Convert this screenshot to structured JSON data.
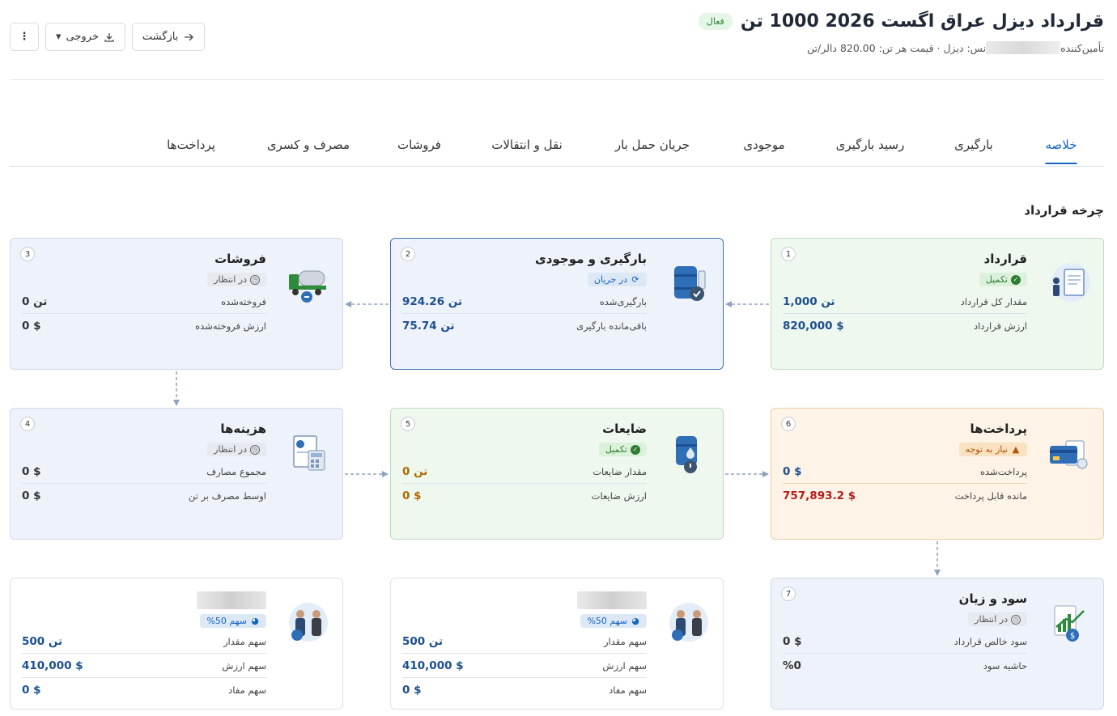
{
  "header": {
    "title": "قرارداد دیزل عراق اگست 2026 1000 تن",
    "status_badge": "فعال",
    "subtitle_prefix": "تأمین‌کننده",
    "subtitle_rest": "نس: دیزل · قیمت هر تن: 820.00 دالر/تن"
  },
  "actions": {
    "back": "بازگشت",
    "export": "خروجی",
    "more": "⋮"
  },
  "tabs": [
    "خلاصه",
    "بارگیری",
    "رسید بارگیری",
    "موجودی",
    "جریان حمل بار",
    "نقل و انتقالات",
    "فروشات",
    "مصرف و کسری",
    "پرداخت‌ها"
  ],
  "section_title": "چرخه قرارداد",
  "cards": {
    "contract": {
      "num": "1",
      "title": "قرارداد",
      "status": "تکمیل",
      "rows": [
        {
          "label": "مقدار کل قرارداد",
          "value": "1,000 تن"
        },
        {
          "label": "ارزش قرارداد",
          "value": "820,000 $"
        }
      ]
    },
    "loading": {
      "num": "2",
      "title": "بارگیری و موجودی",
      "status": "در جریان",
      "rows": [
        {
          "label": "بارگیری‌شده",
          "value": "924.26 تن"
        },
        {
          "label": "باقی‌مانده بارگیری",
          "value": "75.74 تن"
        }
      ]
    },
    "sales": {
      "num": "3",
      "title": "فروشات",
      "status": "در انتظار",
      "rows": [
        {
          "label": "فروخته‌شده",
          "value": "0 تن"
        },
        {
          "label": "ارزش فروخته‌شده",
          "value": "0 $"
        }
      ]
    },
    "costs": {
      "num": "4",
      "title": "هزینه‌ها",
      "status": "در انتظار",
      "rows": [
        {
          "label": "مجموع مصارف",
          "value": "0 $"
        },
        {
          "label": "اوسط مصرف بر تن",
          "value": "0 $"
        }
      ]
    },
    "waste": {
      "num": "5",
      "title": "ضایعات",
      "status": "تکمیل",
      "rows": [
        {
          "label": "مقدار ضایعات",
          "value": "0 تن"
        },
        {
          "label": "ارزش ضایعات",
          "value": "0 $"
        }
      ]
    },
    "payments": {
      "num": "6",
      "title": "پرداخت‌ها",
      "status": "نیاز به توجه",
      "rows": [
        {
          "label": "پرداخت‌شده",
          "value": "0 $"
        },
        {
          "label": "مانده قابل پرداخت",
          "value": "757,893.2 $"
        }
      ]
    },
    "profit": {
      "num": "7",
      "title": "سود و زیان",
      "status": "در انتظار",
      "rows": [
        {
          "label": "سود خالص قرارداد",
          "value": "0 $"
        },
        {
          "label": "حاشیه سود",
          "value": "%0"
        }
      ]
    },
    "partner_a": {
      "share_badge": "سهم 50%",
      "rows": [
        {
          "label": "سهم مقدار",
          "value": "500 تن"
        },
        {
          "label": "سهم ارزش",
          "value": "410,000 $"
        },
        {
          "label": "سهم مفاد",
          "value": "0 $"
        }
      ]
    },
    "partner_b": {
      "share_badge": "سهم 50%",
      "rows": [
        {
          "label": "سهم مقدار",
          "value": "500 تن"
        },
        {
          "label": "سهم ارزش",
          "value": "410,000 $"
        },
        {
          "label": "سهم مفاد",
          "value": "0 $"
        }
      ]
    }
  },
  "colors": {
    "accent": "#1565c0",
    "green_card": "#eff8ee",
    "orange_card": "#fdf3e6",
    "blue_card": "#eef3fb"
  }
}
